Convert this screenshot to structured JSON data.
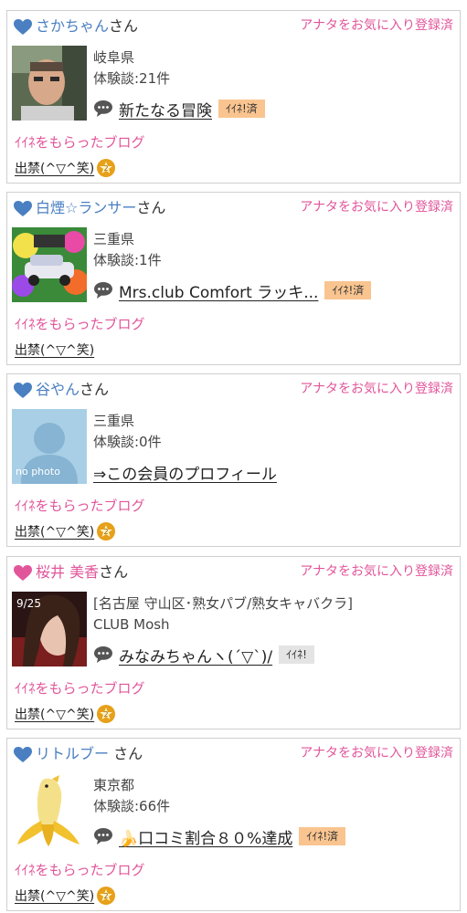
{
  "favorite_label": "アナタをお気に入り登録済",
  "honorific": "さん",
  "liked_blog_label": "ｲｲﾈをもらったブログ",
  "cards": [
    {
      "user_name": "さかちゃん",
      "honorific": "さん",
      "heart_color": "#4a7fc1",
      "line1": "岐阜県",
      "line2": "体験談:21件",
      "blog_title": "新たなる冒険",
      "iine_label": "ｲｲﾈ!済",
      "liked_blogger": "出禁(^▽^笑)"
    },
    {
      "user_name": "白煙☆ランサー",
      "honorific": "さん",
      "heart_color": "#4a7fc1",
      "line1": "三重県",
      "line2": "体験談:1件",
      "blog_title": "Mrs.club Comfort ラッキ...",
      "iine_label": "ｲｲﾈ!済",
      "liked_blogger": "出禁(^▽^笑)"
    },
    {
      "user_name": "谷やん",
      "honorific": "さん",
      "heart_color": "#4a7fc1",
      "line1": "三重県",
      "line2": "体験談:0件",
      "profile_link": "⇒この会員のプロフィール",
      "avatar_text": "no photo",
      "liked_blogger": "出禁(^▽^笑)"
    },
    {
      "user_name": "桜井 美香",
      "honorific": "さん",
      "heart_color": "#e2559a",
      "line1": "[名古屋 守山区･熟女パブ/熟女キャバクラ]",
      "line2": "CLUB Mosh",
      "blog_title": "みなみちゃんヽ(´▽`)/",
      "iine_label": "ｲｲﾈ!",
      "avatar_text": "9/25",
      "liked_blogger": "出禁(^▽^笑)"
    },
    {
      "user_name": "リトルブー",
      "honorific": " さん",
      "heart_color": "#4a7fc1",
      "line1": "東京都",
      "line2": "体験談:66件",
      "blog_title": "🍌口コミ割合８０%達成",
      "iine_label": "ｲｲﾈ!済",
      "liked_blogger": "出禁(^▽^笑)"
    }
  ]
}
